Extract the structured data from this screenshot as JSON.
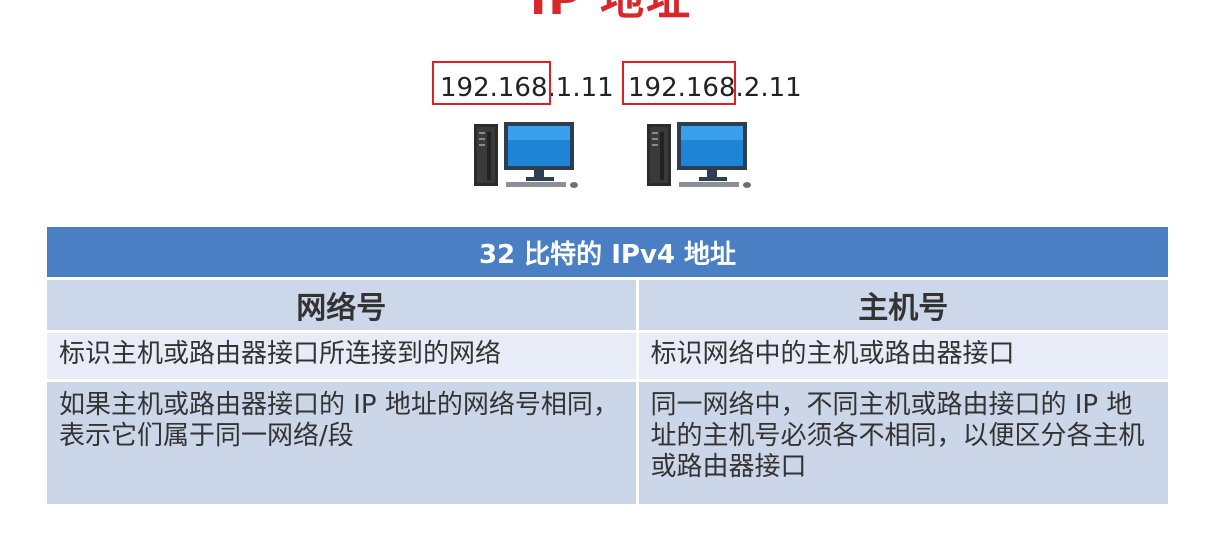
{
  "slide": {
    "title": "IP 地址"
  },
  "addresses": {
    "left": {
      "prefix": "192.168",
      "suffix": ".1.11"
    },
    "right": {
      "prefix": "192.168",
      "suffix": ".2.11"
    }
  },
  "table": {
    "caption": "32 比特的 IPv4 地址",
    "columns": [
      "网络号",
      "主机号"
    ],
    "rows": [
      [
        "标识主机或路由器接口所连接到的网络",
        "标识网络中的主机或路由器接口"
      ],
      [
        "如果主机或路由器接口的 IP 地址的网络号相同，表示它们属于同一网络/段",
        "同一网络中，不同主机或路由接口的 IP 地址的主机号必须各不相同，以便区分各主机或路由器接口"
      ]
    ]
  },
  "colors": {
    "title": "#d9262b",
    "highlight_box": "#e02020",
    "table_caption_bg": "#4b7fc4",
    "table_header_bg": "#cdd7ea",
    "row_light_bg": "#e7ecf6",
    "row_dark_bg": "#ccd6e9"
  },
  "icons": [
    "computer-icon",
    "computer-icon"
  ]
}
